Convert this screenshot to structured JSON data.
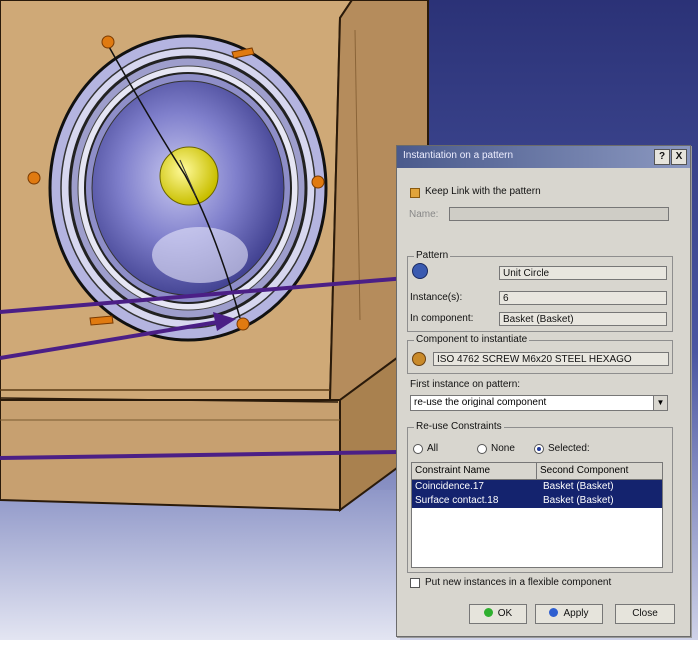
{
  "dialog": {
    "title": "Instantiation on a pattern",
    "help_button": "?",
    "close_glyph": "X",
    "keep_link_label": "Keep Link with the pattern",
    "keep_link_checked": true,
    "name_label": "Name:",
    "name_value": "",
    "pattern_group_title": "Pattern",
    "pattern_value": "Unit Circle",
    "instances_label": "Instance(s):",
    "instances_value": "6",
    "in_component_label": "In component:",
    "in_component_value": "Basket (Basket)",
    "component_group_title": "Component to instantiate",
    "component_value": "ISO 4762 SCREW M6x20 STEEL HEXAGO",
    "first_instance_label": "First instance on pattern:",
    "first_instance_value": "re-use the original component",
    "reuse_group_title": "Re-use Constraints",
    "radio_all": "All",
    "radio_none": "None",
    "radio_selected": "Selected:",
    "radio_selected_choice": "Selected",
    "table": {
      "columns": [
        "Constraint Name",
        "Second Component"
      ],
      "rows": [
        {
          "name": "Coincidence.17",
          "second": "Basket (Basket)"
        },
        {
          "name": "Surface contact.18",
          "second": "Basket (Basket)"
        }
      ]
    },
    "flexible_label": "Put new instances in a flexible component",
    "flexible_checked": false,
    "ok_label": "OK",
    "apply_label": "Apply",
    "close_label": "Close"
  },
  "colors": {
    "box_wood": "#c8a57a",
    "speaker_cone": "#6f6fbf",
    "dust_cap": "#e8e01a",
    "arrow": "#4b1f86",
    "marker": "#e07a10",
    "window_bg": "#2b3277",
    "selection": "#14236e"
  },
  "icons": [
    "pattern-icon",
    "component-icon",
    "ok-icon",
    "apply-icon"
  ]
}
